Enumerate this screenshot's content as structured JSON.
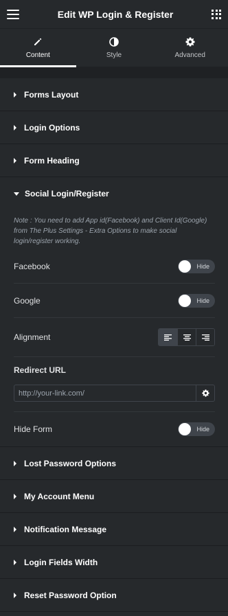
{
  "header": {
    "title": "Edit WP Login & Register",
    "menu_icon": "hamburger-icon",
    "apps_icon": "grid-icon"
  },
  "tabs": [
    {
      "label": "Content",
      "icon": "pencil-icon",
      "active": true
    },
    {
      "label": "Style",
      "icon": "contrast-icon",
      "active": false
    },
    {
      "label": "Advanced",
      "icon": "gear-icon",
      "active": false
    }
  ],
  "sections_top": [
    {
      "title": "Forms Layout"
    },
    {
      "title": "Login Options"
    },
    {
      "title": "Form Heading"
    }
  ],
  "social": {
    "title": "Social Login/Register",
    "note": "Note : You need to add App id(Facebook) and Client Id(Google) from The Plus Settings - Extra Options to make social login/register working.",
    "facebook": {
      "label": "Facebook",
      "toggle": "Hide"
    },
    "google": {
      "label": "Google",
      "toggle": "Hide"
    },
    "alignment": {
      "label": "Alignment",
      "selected": "left",
      "options": [
        "left",
        "center",
        "right"
      ]
    },
    "redirect": {
      "label": "Redirect URL",
      "placeholder": "http://your-link.com/",
      "value": ""
    },
    "hide_form": {
      "label": "Hide Form",
      "toggle": "Hide"
    }
  },
  "sections_bottom": [
    {
      "title": "Lost Password Options"
    },
    {
      "title": "My Account Menu"
    },
    {
      "title": "Notification Message"
    },
    {
      "title": "Login Fields Width"
    },
    {
      "title": "Reset Password Option"
    }
  ],
  "colors": {
    "panel": "#26292c",
    "separator": "#1f2124",
    "text": "#e0e1e3",
    "muted": "#9da5ae"
  }
}
